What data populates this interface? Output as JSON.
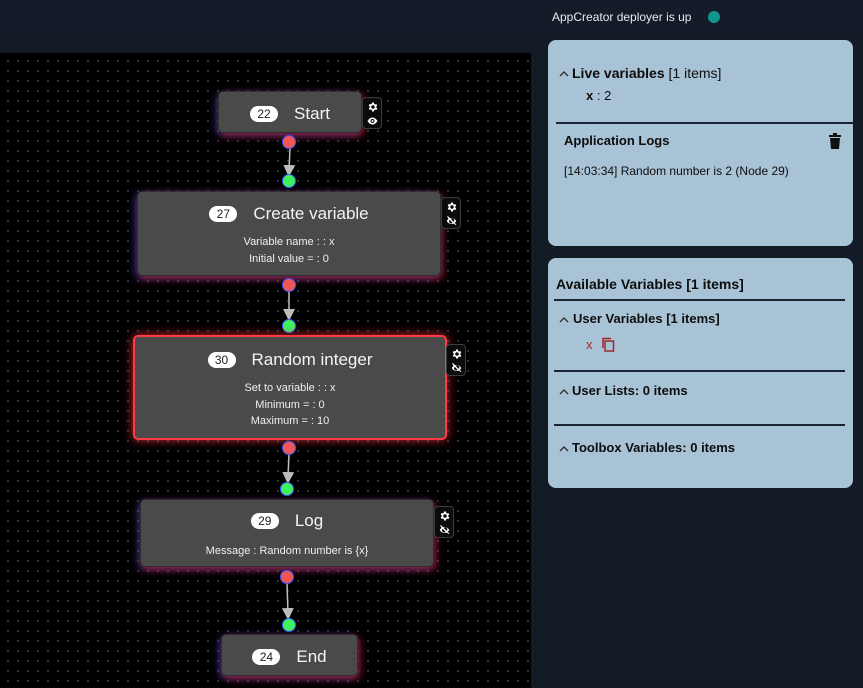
{
  "status": {
    "deployer_text": "AppCreator deployer is up",
    "dot_color": "#12948f"
  },
  "flow": {
    "nodes": [
      {
        "id": "22",
        "title": "Start",
        "props": [],
        "visibility_icon": "eye-icon"
      },
      {
        "id": "27",
        "title": "Create variable",
        "props": [
          "Variable name : : x",
          "Initial value = : 0"
        ],
        "visibility_icon": "eye-off-icon"
      },
      {
        "id": "30",
        "title": "Random integer",
        "props": [
          "Set to variable : : x",
          "Minimum = : 0",
          "Maximum = : 10"
        ],
        "visibility_icon": "eye-off-icon",
        "selected": true
      },
      {
        "id": "29",
        "title": "Log",
        "props": [
          "Message : Random number is {x}"
        ],
        "visibility_icon": "eye-off-icon"
      },
      {
        "id": "24",
        "title": "End",
        "props": []
      }
    ]
  },
  "live_panel": {
    "live_variables_label": "Live variables",
    "live_variables_count": "[1 items]",
    "variables": [
      {
        "name": "x",
        "sep": " : ",
        "value": "2"
      }
    ],
    "logs_title": "Application Logs",
    "logs": [
      "[14:03:34] Random number is 2 (Node 29)"
    ]
  },
  "vars_panel": {
    "title": "Available Variables [1 items]",
    "user_variables_label": "User Variables [1 items]",
    "user_variables": [
      "x"
    ],
    "user_lists_label": "User Lists: 0 items",
    "toolbox_label": "Toolbox Variables: 0 items"
  }
}
